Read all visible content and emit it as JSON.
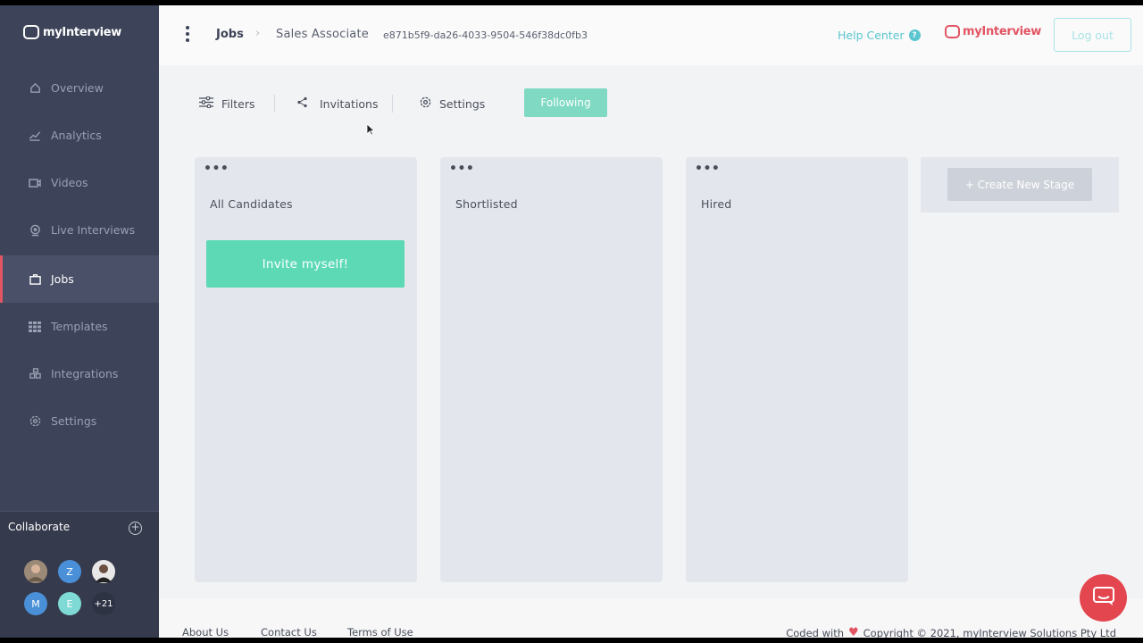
{
  "sidebar": {
    "logo": "myInterview",
    "items": [
      {
        "label": "Overview",
        "icon": "home-icon"
      },
      {
        "label": "Analytics",
        "icon": "chart-icon"
      },
      {
        "label": "Videos",
        "icon": "video-icon"
      },
      {
        "label": "Live Interviews",
        "icon": "webcam-icon"
      },
      {
        "label": "Jobs",
        "icon": "briefcase-icon",
        "active": true
      },
      {
        "label": "Templates",
        "icon": "grid-icon"
      },
      {
        "label": "Integrations",
        "icon": "integrations-icon"
      },
      {
        "label": "Settings",
        "icon": "gear-icon"
      }
    ],
    "collaborate": {
      "title": "Collaborate",
      "avatars": [
        {
          "initial": "",
          "color": "#8a7a6a"
        },
        {
          "initial": "Z",
          "color": "#4a90d9"
        },
        {
          "initial": "",
          "color": "#5b5b5b"
        },
        {
          "initial": "M",
          "color": "#4a90d9"
        },
        {
          "initial": "E",
          "color": "#7fd9d4"
        }
      ],
      "more": "+21"
    }
  },
  "header": {
    "breadcrumb_root": "Jobs",
    "breadcrumb_sep": "›",
    "job_title": "Sales Associate",
    "job_id": "e871b5f9-da26-4033-9504-546f38dc0fb3",
    "help": "Help Center",
    "brand": "myInterview",
    "logout": "Log out"
  },
  "toolbar": {
    "filters": "Filters",
    "invitations": "Invitations",
    "settings": "Settings",
    "following": "Following"
  },
  "stages": [
    {
      "title": "All Candidates",
      "menu": "•••"
    },
    {
      "title": "Shortlisted",
      "menu": "•••"
    },
    {
      "title": "Hired",
      "menu": "•••"
    }
  ],
  "invite_button": "Invite myself!",
  "create_stage": "+ Create New Stage",
  "footer": {
    "about": "About Us",
    "contact": "Contact Us",
    "terms": "Terms of Use",
    "coded_with": "Coded with",
    "copyright": "Copyright © 2021, myInterview Solutions Pty Ltd"
  },
  "colors": {
    "accent": "#5dd9b6",
    "brand": "#e25563",
    "sidebar": "#3d4358"
  }
}
